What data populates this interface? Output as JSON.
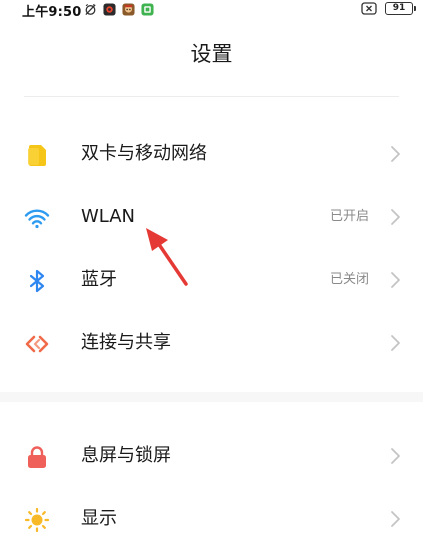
{
  "status_bar": {
    "time": "上午9:50",
    "battery": "91"
  },
  "header": {
    "title": "设置"
  },
  "settings": {
    "items": [
      {
        "label": "双卡与移动网络",
        "status": "",
        "icon": "sim-card-icon",
        "color": "#f5c518"
      },
      {
        "label": "WLAN",
        "status": "已开启",
        "icon": "wifi-icon",
        "color": "#2e9bf0"
      },
      {
        "label": "蓝牙",
        "status": "已关闭",
        "icon": "bluetooth-icon",
        "color": "#2e86f0"
      },
      {
        "label": "连接与共享",
        "status": "",
        "icon": "connection-sharing-icon",
        "color": "#f06a4a"
      },
      {
        "label": "息屏与锁屏",
        "status": "",
        "icon": "lock-icon",
        "color": "#f0605a"
      },
      {
        "label": "显示",
        "status": "",
        "icon": "brightness-icon",
        "color": "#f7b928"
      }
    ]
  },
  "colors": {
    "annotation_arrow": "#e53935",
    "status_text": "#8a8a8a",
    "chevron": "#c4c4c4"
  }
}
